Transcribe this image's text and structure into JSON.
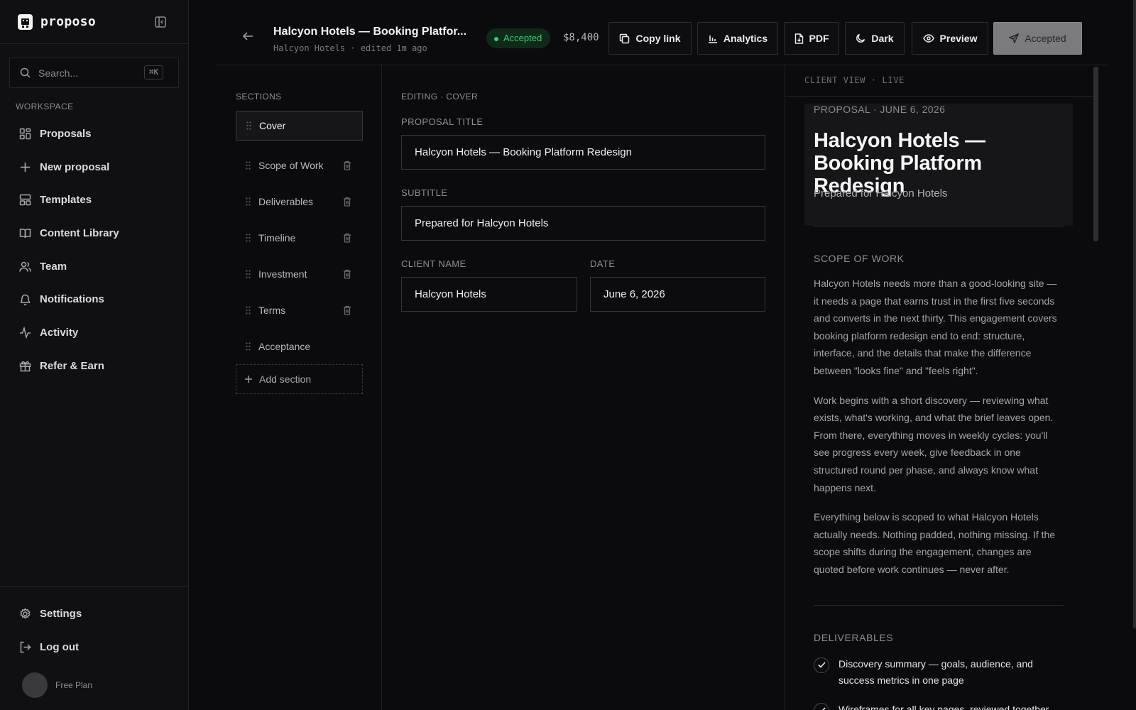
{
  "app": {
    "name": "proposo"
  },
  "search": {
    "placeholder": "Search...",
    "shortcut": "⌘K"
  },
  "sidebar": {
    "section_label": "WORKSPACE",
    "items": [
      {
        "label": "Proposals",
        "icon": "grid-icon"
      },
      {
        "label": "New proposal",
        "icon": "plus-icon"
      },
      {
        "label": "Templates",
        "icon": "template-icon"
      },
      {
        "label": "Content Library",
        "icon": "book-icon"
      },
      {
        "label": "Team",
        "icon": "users-icon"
      },
      {
        "label": "Notifications",
        "icon": "bell-icon"
      },
      {
        "label": "Activity",
        "icon": "activity-icon"
      },
      {
        "label": "Refer & Earn",
        "icon": "gift-icon"
      }
    ],
    "bottom": [
      {
        "label": "Settings",
        "icon": "gear-icon"
      },
      {
        "label": "Log out",
        "icon": "logout-icon"
      }
    ],
    "plan": "Free Plan"
  },
  "header": {
    "title": "Halcyon Hotels — Booking Platfor...",
    "meta": "Halcyon Hotels · edited 1m ago",
    "status": "Accepted",
    "price": "$8,400",
    "buttons": {
      "copy_link": "Copy link",
      "analytics": "Analytics",
      "pdf": "PDF",
      "dark": "Dark",
      "preview": "Preview",
      "accepted": "Accepted"
    }
  },
  "sections": {
    "label": "SECTIONS",
    "items": [
      "Cover",
      "Scope of Work",
      "Deliverables",
      "Timeline",
      "Investment",
      "Terms",
      "Acceptance"
    ],
    "add_label": "Add section"
  },
  "editor": {
    "label": "EDITING · COVER",
    "fields": {
      "title_label": "PROPOSAL TITLE",
      "title_value": "Halcyon Hotels — Booking Platform Redesign",
      "subtitle_label": "SUBTITLE",
      "subtitle_value": "Prepared for Halcyon Hotels",
      "client_label": "CLIENT NAME",
      "client_value": "Halcyon Hotels",
      "date_label": "DATE",
      "date_value": "June 6, 2026"
    }
  },
  "preview": {
    "label": "CLIENT VIEW · LIVE",
    "eyebrow": "PROPOSAL · JUNE 6, 2026",
    "title": "Halcyon Hotels — Booking Platform Redesign",
    "subtitle": "Prepared for Halcyon Hotels",
    "scope_heading": "SCOPE OF WORK",
    "scope_paragraphs": [
      "Halcyon Hotels needs more than a good-looking site — it needs a page that earns trust in the first five seconds and converts in the next thirty. This engagement covers booking platform redesign end to end: structure, interface, and the details that make the difference between \"looks fine\" and \"feels right\".",
      "Work begins with a short discovery — reviewing what exists, what's working, and what the brief leaves open. From there, everything moves in weekly cycles: you'll see progress every week, give feedback in one structured round per phase, and always know what happens next.",
      "Everything below is scoped to what Halcyon Hotels actually needs. Nothing padded, nothing missing. If the scope shifts during the engagement, changes are quoted before work continues — never after."
    ],
    "deliverables_heading": "DELIVERABLES",
    "deliverables": [
      "Discovery summary — goals, audience, and success metrics in one page",
      "Wireframes for all key pages, reviewed together"
    ]
  },
  "colors": {
    "accent_green": "#38d06b",
    "background": "#0b0b0d"
  }
}
